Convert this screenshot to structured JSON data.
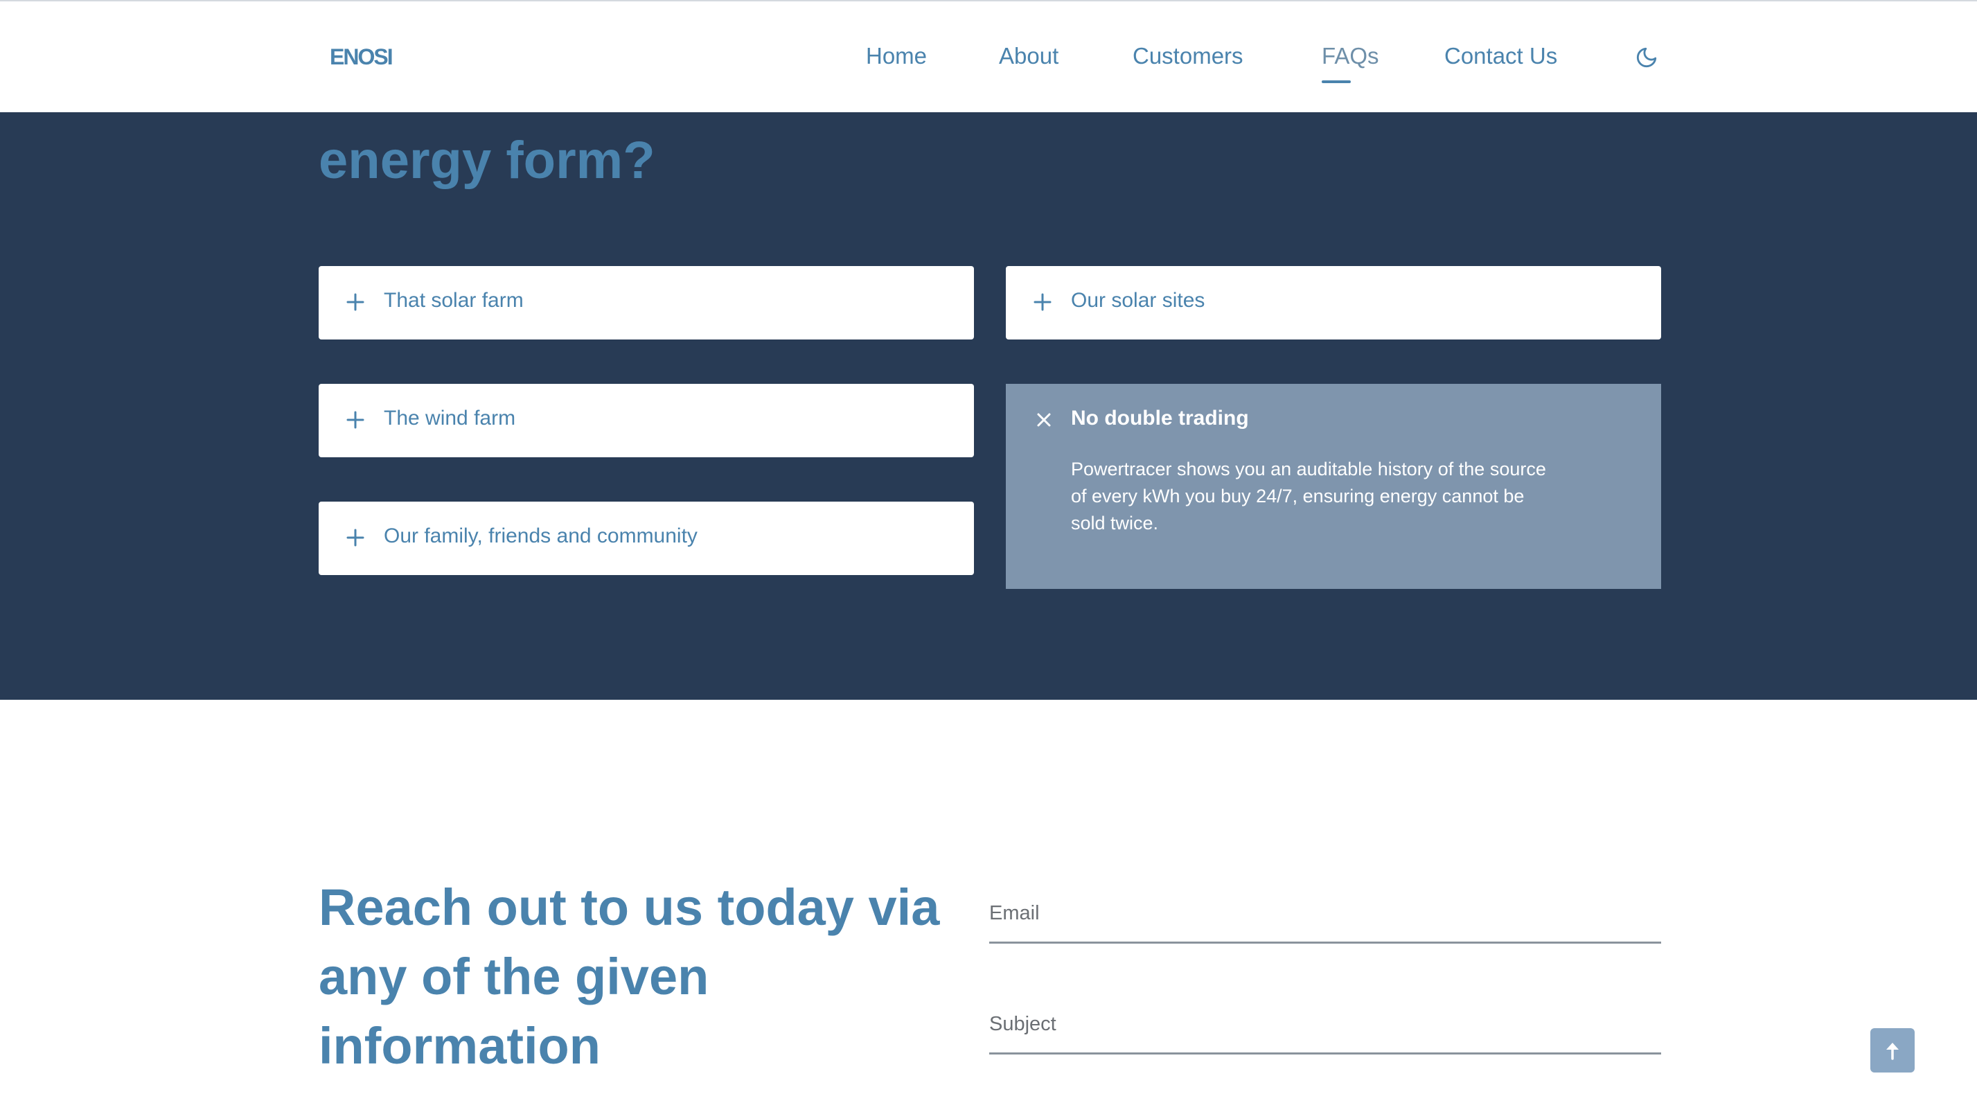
{
  "header": {
    "logo": "ENOSI",
    "nav": [
      {
        "label": "Home"
      },
      {
        "label": "About"
      },
      {
        "label": "Customers"
      },
      {
        "label": "FAQs",
        "active": true
      },
      {
        "label": "Contact Us"
      }
    ],
    "theme_toggle_icon": "moon-icon"
  },
  "faq": {
    "title": "energy form?",
    "left": [
      {
        "question": "That solar farm",
        "icon": "plus-icon"
      },
      {
        "question": "The wind farm",
        "icon": "plus-icon"
      },
      {
        "question": "Our family, friends and community",
        "icon": "plus-icon"
      }
    ],
    "right": [
      {
        "question": "Our solar sites",
        "icon": "plus-icon"
      },
      {
        "question": "No double trading",
        "icon": "close-icon",
        "expanded": true,
        "answer": "Powertracer shows you an auditable history of the source of every kWh you buy 24/7, ensuring energy cannot be sold twice."
      }
    ]
  },
  "contact": {
    "heading": "Reach out to us today via any of the given information",
    "email_placeholder": "Email",
    "subject_placeholder": "Subject"
  },
  "back_to_top_icon": "arrow-up-icon",
  "colors": {
    "brand": "#4a83ad",
    "band": "#283b55",
    "expanded_card": "#7f95ad"
  }
}
